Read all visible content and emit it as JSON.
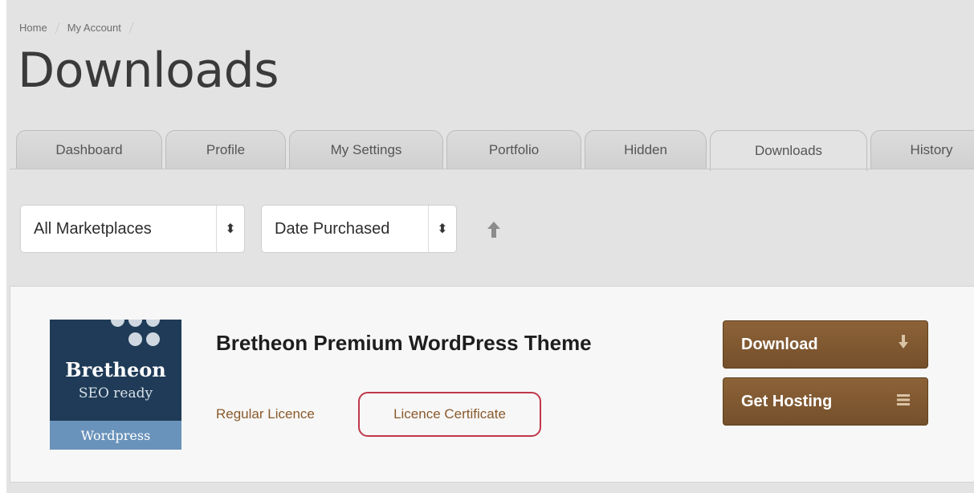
{
  "breadcrumb": {
    "items": [
      "Home",
      "My Account"
    ]
  },
  "page": {
    "title": "Downloads"
  },
  "tabs": [
    {
      "label": "Dashboard"
    },
    {
      "label": "Profile"
    },
    {
      "label": "My Settings"
    },
    {
      "label": "Portfolio"
    },
    {
      "label": "Hidden"
    },
    {
      "label": "Downloads"
    },
    {
      "label": "History"
    }
  ],
  "active_tab": "Downloads",
  "filters": {
    "marketplace": {
      "value": "All Marketplaces"
    },
    "sort": {
      "value": "Date Purchased"
    },
    "sort_direction_icon": "arrow-up-icon"
  },
  "item": {
    "thumbnail": {
      "brand": "Bretheon",
      "tagline": "SEO ready",
      "band": "Wordpress"
    },
    "title": "Bretheon Premium WordPress Theme",
    "licence_label": "Regular Licence",
    "certificate_label": "Licence Certificate",
    "download_label": "Download",
    "download_icon": "download-arrow-icon",
    "hosting_label": "Get Hosting",
    "hosting_icon": "list-icon"
  },
  "colors": {
    "accent_brown": "#7e5731",
    "link_brown": "#8a5a2b",
    "highlight_red": "#c0374a",
    "thumb_navy": "#1f3b57"
  }
}
